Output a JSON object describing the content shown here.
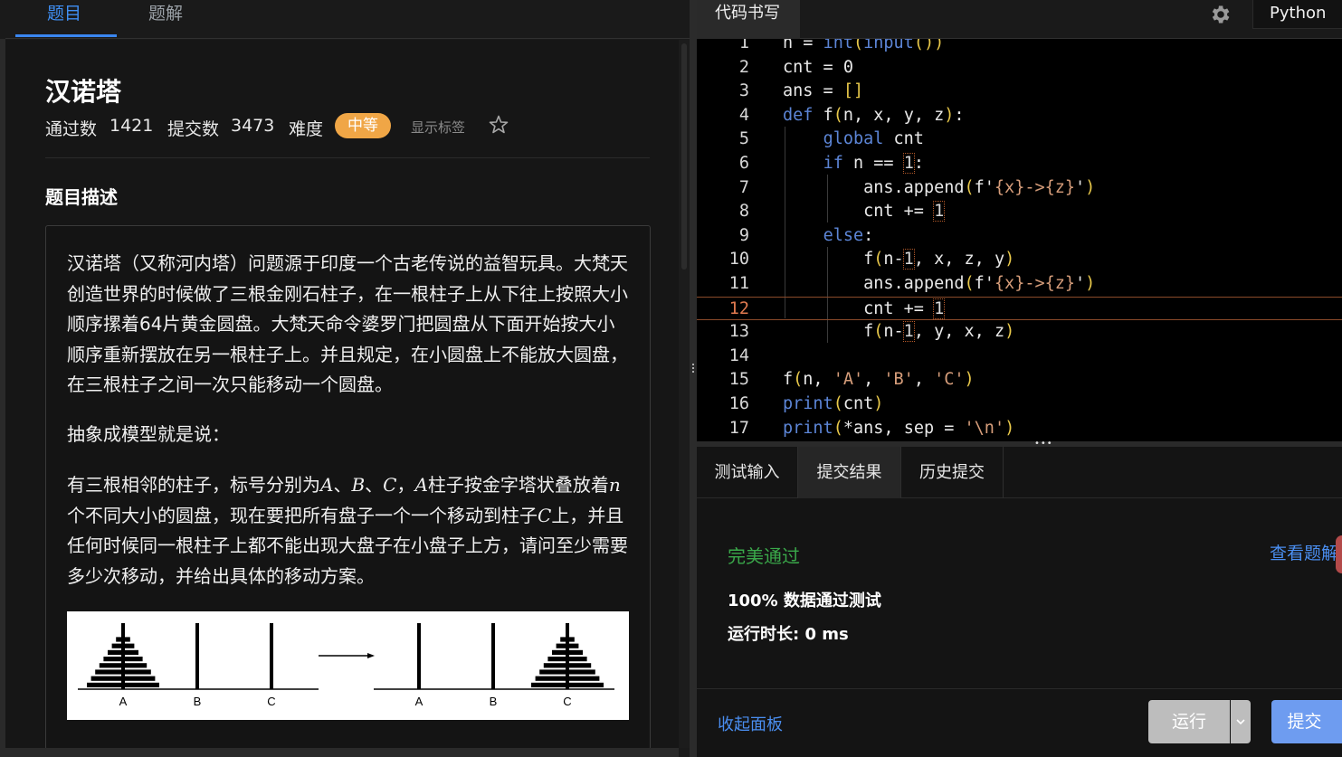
{
  "left_tabs": {
    "problem": "题目",
    "solution": "题解"
  },
  "problem": {
    "title": "汉诺塔",
    "accepted_label": "通过数",
    "accepted_count": "1421",
    "submissions_label": "提交数",
    "submissions_count": "3473",
    "difficulty_label": "难度",
    "difficulty": "中等",
    "show_tags": "显示标签",
    "section_title": "题目描述",
    "para1": "汉诺塔（又称河内塔）问题源于印度一个古老传说的益智玩具。大梵天创造世界的时候做了三根金刚石柱子，在一根柱子上从下往上按照大小顺序摞着64片黄金圆盘。大梵天命令婆罗门把圆盘从下面开始按大小顺序重新摆放在另一根柱子上。并且规定，在小圆盘上不能放大圆盘，在三根柱子之间一次只能移动一个圆盘。",
    "para2": "抽象成模型就是说：",
    "para3": {
      "t1": "有三根相邻的柱子，标号分别为",
      "a": "A",
      "sep1": "、",
      "b": "B",
      "sep2": "、",
      "c": "C",
      "t2": "，",
      "a2": "A",
      "t3": "柱子按金字塔状叠放着",
      "n": "n",
      "t4": "个不同大小的圆盘，现在要把所有盘子一个一个移动到柱子",
      "c2": "C",
      "t5": "上，并且任何时候同一根柱子上都不能出现大盘子在小盘子上方，请问至少需要多少次移动，并给出具体的移动方案。"
    },
    "figure_labels": [
      "A",
      "B",
      "C",
      "A",
      "B",
      "C"
    ],
    "disk_count": 8
  },
  "editor": {
    "tab_label": "代码书写",
    "language": "Python",
    "current_line": 12,
    "lines": [
      {
        "n": "1",
        "code": "n = int(input())"
      },
      {
        "n": "2",
        "code": "cnt = 0"
      },
      {
        "n": "3",
        "code": "ans = []"
      },
      {
        "n": "4",
        "code": "def f(n, x, y, z):"
      },
      {
        "n": "5",
        "code": "    global cnt"
      },
      {
        "n": "6",
        "code": "    if n == 1:"
      },
      {
        "n": "7",
        "code": "        ans.append(f'{x}->{z}')"
      },
      {
        "n": "8",
        "code": "        cnt += 1"
      },
      {
        "n": "9",
        "code": "    else:"
      },
      {
        "n": "10",
        "code": "        f(n-1, x, z, y)"
      },
      {
        "n": "11",
        "code": "        ans.append(f'{x}->{z}')"
      },
      {
        "n": "12",
        "code": "        cnt += 1"
      },
      {
        "n": "13",
        "code": "        f(n-1, y, x, z)"
      },
      {
        "n": "14",
        "code": ""
      },
      {
        "n": "15",
        "code": "f(n, 'A', 'B', 'C')"
      },
      {
        "n": "16",
        "code": "print(cnt)"
      },
      {
        "n": "17",
        "code": "print(*ans, sep = '\\n')"
      }
    ]
  },
  "result": {
    "tabs": [
      "测试输入",
      "提交结果",
      "历史提交"
    ],
    "active_tab": "提交结果",
    "status": "完美通过",
    "view_solution": "查看题解",
    "pass_rate": "100% 数据通过测试",
    "runtime": "运行时长: 0 ms",
    "collapse": "收起面板",
    "run": "运行",
    "submit": "提交"
  },
  "colors": {
    "accent": "#3f8ef2",
    "difficulty_badge": "#f0a646",
    "success": "#3aa84a",
    "keyword": "#5c85d6",
    "string": "#d69d7a",
    "bracket": "#e8c84a",
    "submit": "#6e9cf0"
  }
}
